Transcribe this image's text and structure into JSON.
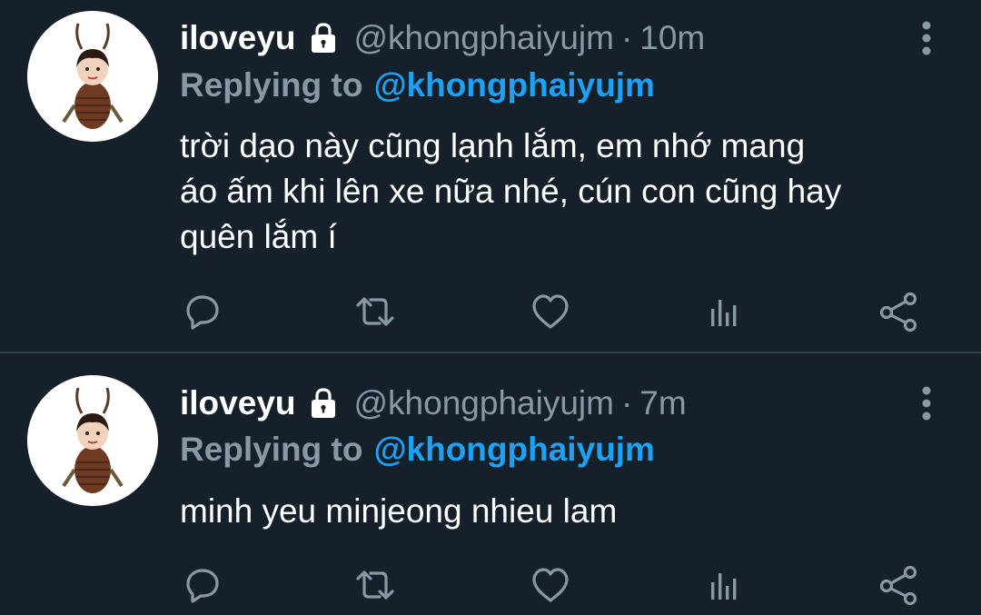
{
  "tweets": [
    {
      "display_name": "iloveyu",
      "handle": "@khongphaiyujm",
      "separator": "·",
      "time": "10m",
      "replying_label": "Replying to",
      "replying_to": "@khongphaiyujm",
      "text_lines": [
        "trời dạo này cũng lạnh lắm, em nhớ mang",
        "áo ấm khi lên xe nữa nhé, cún con cũng hay",
        "quên lắm í"
      ],
      "protected_icon": "lock-icon",
      "action_icons": [
        "reply-icon",
        "retweet-icon",
        "like-icon",
        "analytics-icon",
        "share-icon"
      ]
    },
    {
      "display_name": "iloveyu",
      "handle": "@khongphaiyujm",
      "separator": "·",
      "time": "7m",
      "replying_label": "Replying to",
      "replying_to": "@khongphaiyujm",
      "text_lines": [
        "minh yeu minjeong nhieu lam"
      ],
      "protected_icon": "lock-icon",
      "action_icons": [
        "reply-icon",
        "retweet-icon",
        "like-icon",
        "analytics-icon",
        "share-icon"
      ]
    }
  ],
  "colors": {
    "background": "#15202b",
    "secondary_text": "#8899a6",
    "accent": "#1da1f2",
    "divider": "#38444d"
  }
}
